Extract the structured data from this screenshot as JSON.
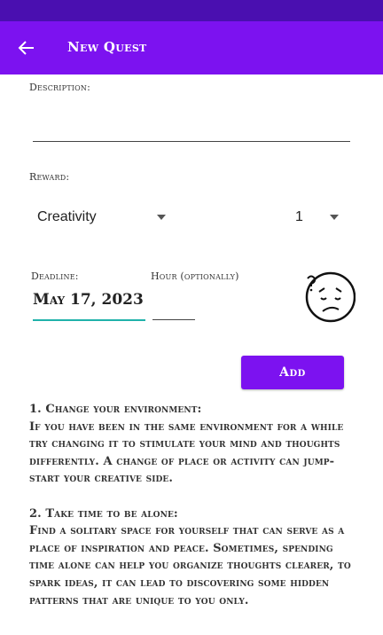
{
  "app_bar": {
    "title": "New Quest"
  },
  "form": {
    "description_label": "Description:",
    "reward_label": "Reward:",
    "reward_category": "Creativity",
    "reward_amount": "1",
    "deadline_label": "Deadline:",
    "deadline_value": "May 17, 2023",
    "hour_label": "Hour (optionally)",
    "add_button": "Add"
  },
  "tips": {
    "tip1_title": "1. Change your environment:",
    "tip1_body": "If you have been in the same environment for a while try changing it to stimulate your mind and thoughts differently. A change of place or activity can jump-start your creative side.",
    "tip2_title": "2. Take time to be alone:",
    "tip2_body": "Find a solitary space for yourself that can serve as a place of inspiration and peace. Sometimes, spending time alone can help you organize thoughts clearer, to spark ideas, it can lead to discovering some hidden patterns that are unique to you only."
  },
  "colors": {
    "primary": "#7c12f0",
    "status_bar": "#4a0fb0",
    "accent_underline": "#20b2aa"
  },
  "icons": {
    "back": "arrow-left-icon",
    "mood": "confused-face-icon",
    "dropdown": "caret-down-icon"
  }
}
